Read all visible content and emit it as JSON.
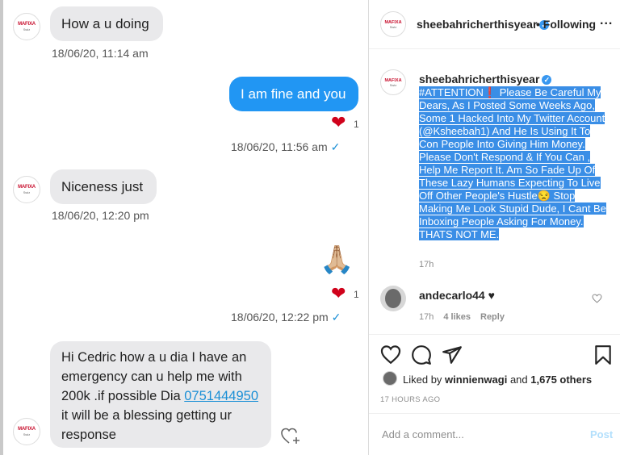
{
  "chat": {
    "avatar_logo": "MAFIXA",
    "avatar_sub": "Swiz",
    "messages": [
      {
        "text": "How a u doing",
        "time": "18/06/20, 11:14 am"
      },
      {
        "text": "I am fine and you",
        "time": "18/06/20, 11:56 am",
        "reaction_count": "1"
      },
      {
        "text": "Niceness just",
        "time": "18/06/20, 12:20 pm"
      },
      {
        "emoji": "🙏🏼",
        "time": "18/06/20, 12:22 pm",
        "reaction_count": "1"
      },
      {
        "text_before": "Hi Cedric how a u dia I have an emergency can u help me with 200k .if possible Dia ",
        "phone": "0751444950",
        "text_after": " it will be a blessing getting ur response"
      }
    ],
    "check": "✓",
    "heart": "❤"
  },
  "post": {
    "username": "sheebahricherthisyear",
    "verified_mark": "✓",
    "following": "• Following",
    "more": "...",
    "caption": "#ATTENTION❗ Please Be Careful My Dears, As I Posted Some Weeks Ago, Some 1 Hacked Into My Twitter Account (@Ksheebah1) And He Is Using It To Con People Into Giving Him Money. Please Don't Respond & If You Can , Help Me Report It. Am So Fade Up Of These Lazy Humans Expecting To Live Off Other People's Hustle😒 Stop Making Me Look Stupid Dude, I Cant Be Inboxing People Asking For Money. THATS NOT ME.",
    "caption_age": "17h",
    "comment": {
      "username": "andecarlo44",
      "text": "♥",
      "age": "17h",
      "likes": "4 likes",
      "reply": "Reply"
    },
    "liked_by_prefix": "Liked by ",
    "liked_by_user": "winnienwagi",
    "liked_by_mid": " and ",
    "liked_by_others": "1,675 others",
    "post_time": "17 HOURS AGO",
    "add_comment_placeholder": "Add a comment...",
    "post_button": "Post"
  },
  "colors": {
    "outgoing_bubble": "#2196f3",
    "incoming_bubble": "#e9e9eb",
    "highlight": "#3a8ee6",
    "heart": "#d0021b",
    "link": "#1a8fd6"
  }
}
